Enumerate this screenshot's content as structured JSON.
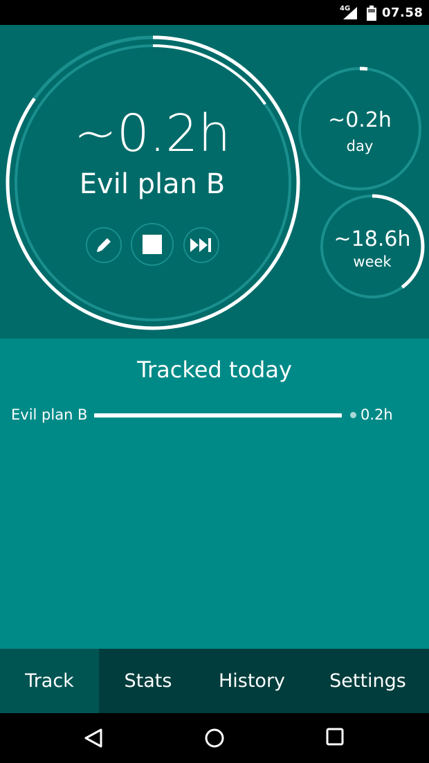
{
  "status_bar": {
    "network": "4G",
    "time": "07.58",
    "icons": [
      "signal-icon",
      "battery-icon"
    ]
  },
  "current": {
    "time": "~0.2h",
    "task": "Evil plan B",
    "controls": [
      "edit-icon",
      "stop-icon",
      "skip-next-icon"
    ]
  },
  "day": {
    "value": "~0.2h",
    "label": "day",
    "progress": 0.02
  },
  "week": {
    "value": "~18.6h",
    "label": "week",
    "progress": 0.4
  },
  "tracked_today": {
    "title": "Tracked today",
    "items": [
      {
        "label": "Evil plan B",
        "value": "0.2h",
        "fraction": 1.0
      }
    ]
  },
  "tabs": [
    {
      "label": "Track",
      "active": true
    },
    {
      "label": "Stats",
      "active": false
    },
    {
      "label": "History",
      "active": false
    },
    {
      "label": "Settings",
      "active": false
    }
  ],
  "nav": [
    "back-icon",
    "home-icon",
    "recents-icon"
  ],
  "colors": {
    "top_panel": "#006b69",
    "lower_panel": "#008a87",
    "tab_bar": "#003d3c",
    "tab_active": "#005553",
    "ring_track": "#1a8f8d"
  }
}
